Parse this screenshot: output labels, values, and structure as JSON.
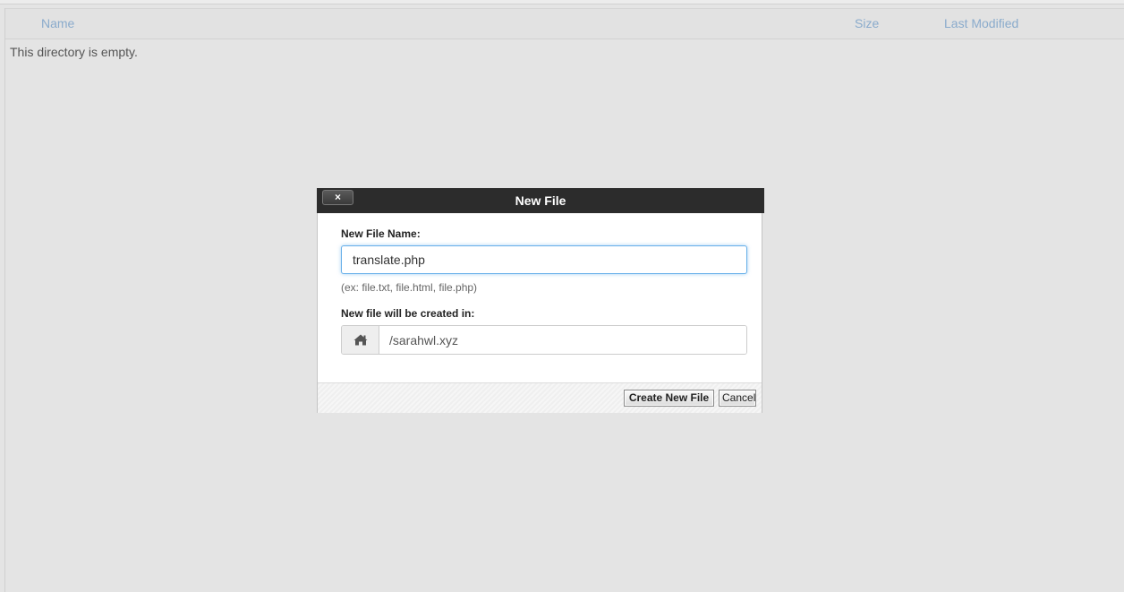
{
  "file_table": {
    "columns": [
      "Name",
      "Size",
      "Last Modified"
    ],
    "empty_message": "This directory is empty."
  },
  "dialog": {
    "title": "New File",
    "close_label": "×",
    "filename_label": "New File Name:",
    "filename_value": "translate.php",
    "hint": "(ex: file.txt, file.html, file.php)",
    "location_label": "New file will be created in:",
    "location_value": "/sarahwl.xyz",
    "location_icon": "home-icon",
    "create_button": "Create New File",
    "cancel_button": "Cancel"
  }
}
